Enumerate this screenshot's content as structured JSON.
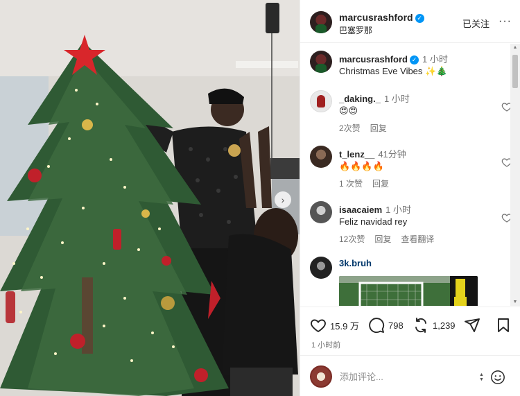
{
  "photo": {
    "next_icon": "chevron-right-icon",
    "next_glyph": "›"
  },
  "post": {
    "username": "marcusrashford",
    "location": "巴塞罗那",
    "follow_label": "已关注",
    "more_glyph": "···",
    "caption": {
      "username": "marcusrashford",
      "time": "1 小时",
      "text": "Christmas Eve Vibes ✨🎄"
    }
  },
  "comments": [
    {
      "username": "_daking._",
      "time": "1 小时",
      "text": "😍😍",
      "likes": "2次赞",
      "reply": "回复"
    },
    {
      "username": "t_lenz__",
      "time": "41分钟",
      "text": "🔥🔥🔥🔥",
      "likes": "1 次赞",
      "reply": "回复"
    },
    {
      "username": "isaacaiem",
      "time": "1 小时",
      "text": "Feliz navidad rey",
      "likes": "12次赞",
      "reply": "回复",
      "translate": "查看翻译"
    },
    {
      "username": "3k.bruh"
    }
  ],
  "actions": {
    "likes": "15.9 万",
    "comments": "798",
    "reposts": "1,239",
    "post_time": "1 小时前"
  },
  "add_comment": {
    "placeholder": "添加评论..."
  },
  "colors": {
    "verified": "#0095f6",
    "muted": "#737373",
    "text": "#262626"
  }
}
